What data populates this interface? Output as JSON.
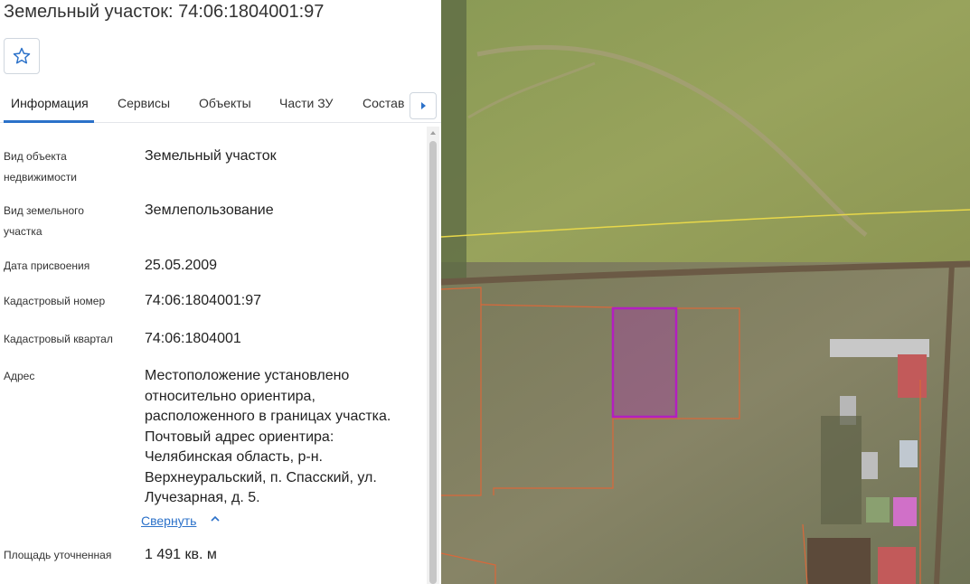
{
  "header": {
    "title": "Земельный участок: 74:06:1804001:97"
  },
  "favorite": {
    "icon": "star-outline-icon"
  },
  "tabs": [
    {
      "label": "Информация",
      "active": true
    },
    {
      "label": "Сервисы"
    },
    {
      "label": "Объекты"
    },
    {
      "label": "Части ЗУ"
    },
    {
      "label": "Состав"
    }
  ],
  "tabs_next_icon": "caret-right-icon",
  "info": {
    "object_type": {
      "label_l1": "Вид объекта",
      "label_l2": "недвижимости",
      "value": "Земельный участок"
    },
    "land_type": {
      "label_l1": "Вид земельного",
      "label_l2": "участка",
      "value": "Землепользование"
    },
    "date": {
      "label": "Дата присвоения",
      "value": "25.05.2009"
    },
    "cad_number": {
      "label": "Кадастровый номер",
      "value": "74:06:1804001:97"
    },
    "cad_quarter": {
      "label": "Кадастровый квартал",
      "value": "74:06:1804001"
    },
    "address": {
      "label": "Адрес",
      "lines": [
        "Местоположение установлено",
        "относительно ориентира,",
        "расположенного в границах участка.",
        "Почтовый адрес ориентира:",
        "Челябинская область, р-н.",
        "Верхнеуральский, п. Спасский, ул.",
        "Лучезарная, д. 5."
      ],
      "collapse_label": "Свернуть"
    },
    "area": {
      "label": "Площадь уточненная",
      "value": "1 491 кв. м"
    }
  },
  "colors": {
    "accent": "#2b71c9",
    "selected_parcel": "#b31fc0",
    "parcel_border": "#d9683a",
    "zone_border": "#e8d84a"
  }
}
